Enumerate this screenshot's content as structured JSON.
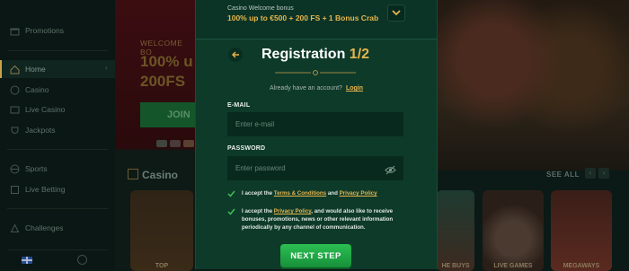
{
  "sidebar": {
    "items": [
      {
        "label": "Promotions",
        "icon": "gift-icon"
      },
      {
        "label": "Home",
        "icon": "home-icon"
      },
      {
        "label": "Casino",
        "icon": "casino-icon"
      },
      {
        "label": "Live Casino",
        "icon": "live-casino-icon"
      },
      {
        "label": "Jackpots",
        "icon": "jackpot-icon"
      },
      {
        "label": "Sports",
        "icon": "sports-icon"
      },
      {
        "label": "Live Betting",
        "icon": "live-betting-icon"
      },
      {
        "label": "Challenges",
        "icon": "challenges-icon"
      }
    ]
  },
  "promo": {
    "welcome": "WELCOME BO",
    "line1": "100% u",
    "line2": "200FS",
    "join": "JOIN"
  },
  "lobby": {
    "section_title": "Casino",
    "see_all": "SEE ALL",
    "tiles": [
      {
        "label": "TOP"
      },
      {
        "label": "HE BUYS"
      },
      {
        "label": "LIVE GAMES"
      },
      {
        "label": "MEGAWAYS"
      }
    ]
  },
  "modal": {
    "bonus_label": "Casino Welcome bonus",
    "bonus_value": "100% up to €500 + 200 FS + 1 Bonus Crab",
    "title": "Registration",
    "step": "1/2",
    "have_account": "Already have an account?",
    "login": "Login",
    "email_label": "E-MAIL",
    "email_placeholder": "Enter e-mail",
    "password_label": "PASSWORD",
    "password_placeholder": "Enter password",
    "terms": {
      "prefix": "I accept the",
      "terms_link": "Terms & Conditions",
      "and": "and",
      "privacy_link": "Privacy Policy"
    },
    "marketing": {
      "prefix": "I accept the",
      "privacy_link": "Privacy Policy",
      "rest": ", and would also like to receive bonuses, promotions, news or other relevant information periodically by any channel of communication."
    },
    "next_button": "NEXT STEP"
  },
  "colors": {
    "modal_bg": "#0e3a2a",
    "accent_gold": "#e6b54d",
    "button_green": "#1fa846"
  }
}
